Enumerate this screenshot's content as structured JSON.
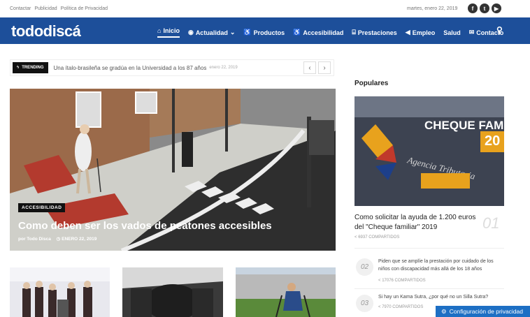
{
  "topbar": {
    "links": [
      "Contactar",
      "Publicidad",
      "Política de Privacidad"
    ],
    "date": "martes, enero 22, 2019",
    "social_icons": [
      "facebook-icon",
      "twitter-icon",
      "youtube-icon"
    ]
  },
  "nav": {
    "logo": "tododiscá",
    "items": [
      {
        "label": "Inicio",
        "icon": "home-icon"
      },
      {
        "label": "Actualidad",
        "icon": "globe-icon"
      },
      {
        "label": "Productos",
        "icon": "wheelchair-icon"
      },
      {
        "label": "Accesibilidad",
        "icon": "accessible-icon"
      },
      {
        "label": "Prestaciones",
        "icon": "bank-icon"
      },
      {
        "label": "Empleo",
        "icon": "megaphone-icon"
      },
      {
        "label": "Salud",
        "icon": ""
      },
      {
        "label": "Contacto",
        "icon": "envelope-icon"
      }
    ],
    "color": "#1d4f9a"
  },
  "trending": {
    "badge": "TRENDING",
    "text": "Una ítalo-brasileña se gradúa en la Universidad a los 87 años",
    "date": "enero 22, 2019"
  },
  "hero": {
    "category": "ACCESIBILIDAD",
    "title": "Como deben ser los vados de peatones accesibles",
    "author": "por Todo Disca",
    "date": "ENERO 22, 2019"
  },
  "sidebar": {
    "title": "Populares",
    "featured": {
      "image_text": "CHEQUE FAMIL",
      "image_number": "20",
      "title": "Como solicitar la ayuda de 1.200 euros del \"Cheque familiar\" 2019",
      "number": "01",
      "shares": "6937 COMPARTIDOS"
    },
    "items": [
      {
        "number": "02",
        "title": "Piden que se amplíe la prestación por cuidado de los niños con discapacidad más allá de los 18 años",
        "shares": "17076 COMPARTIDOS"
      },
      {
        "number": "03",
        "title": "Si hay un Kama Sutra, ¿por qué no un Silla Sutra?",
        "shares": "7970 COMPARTIDOS"
      }
    ]
  },
  "privacy_button": "Configuración de privacidad"
}
